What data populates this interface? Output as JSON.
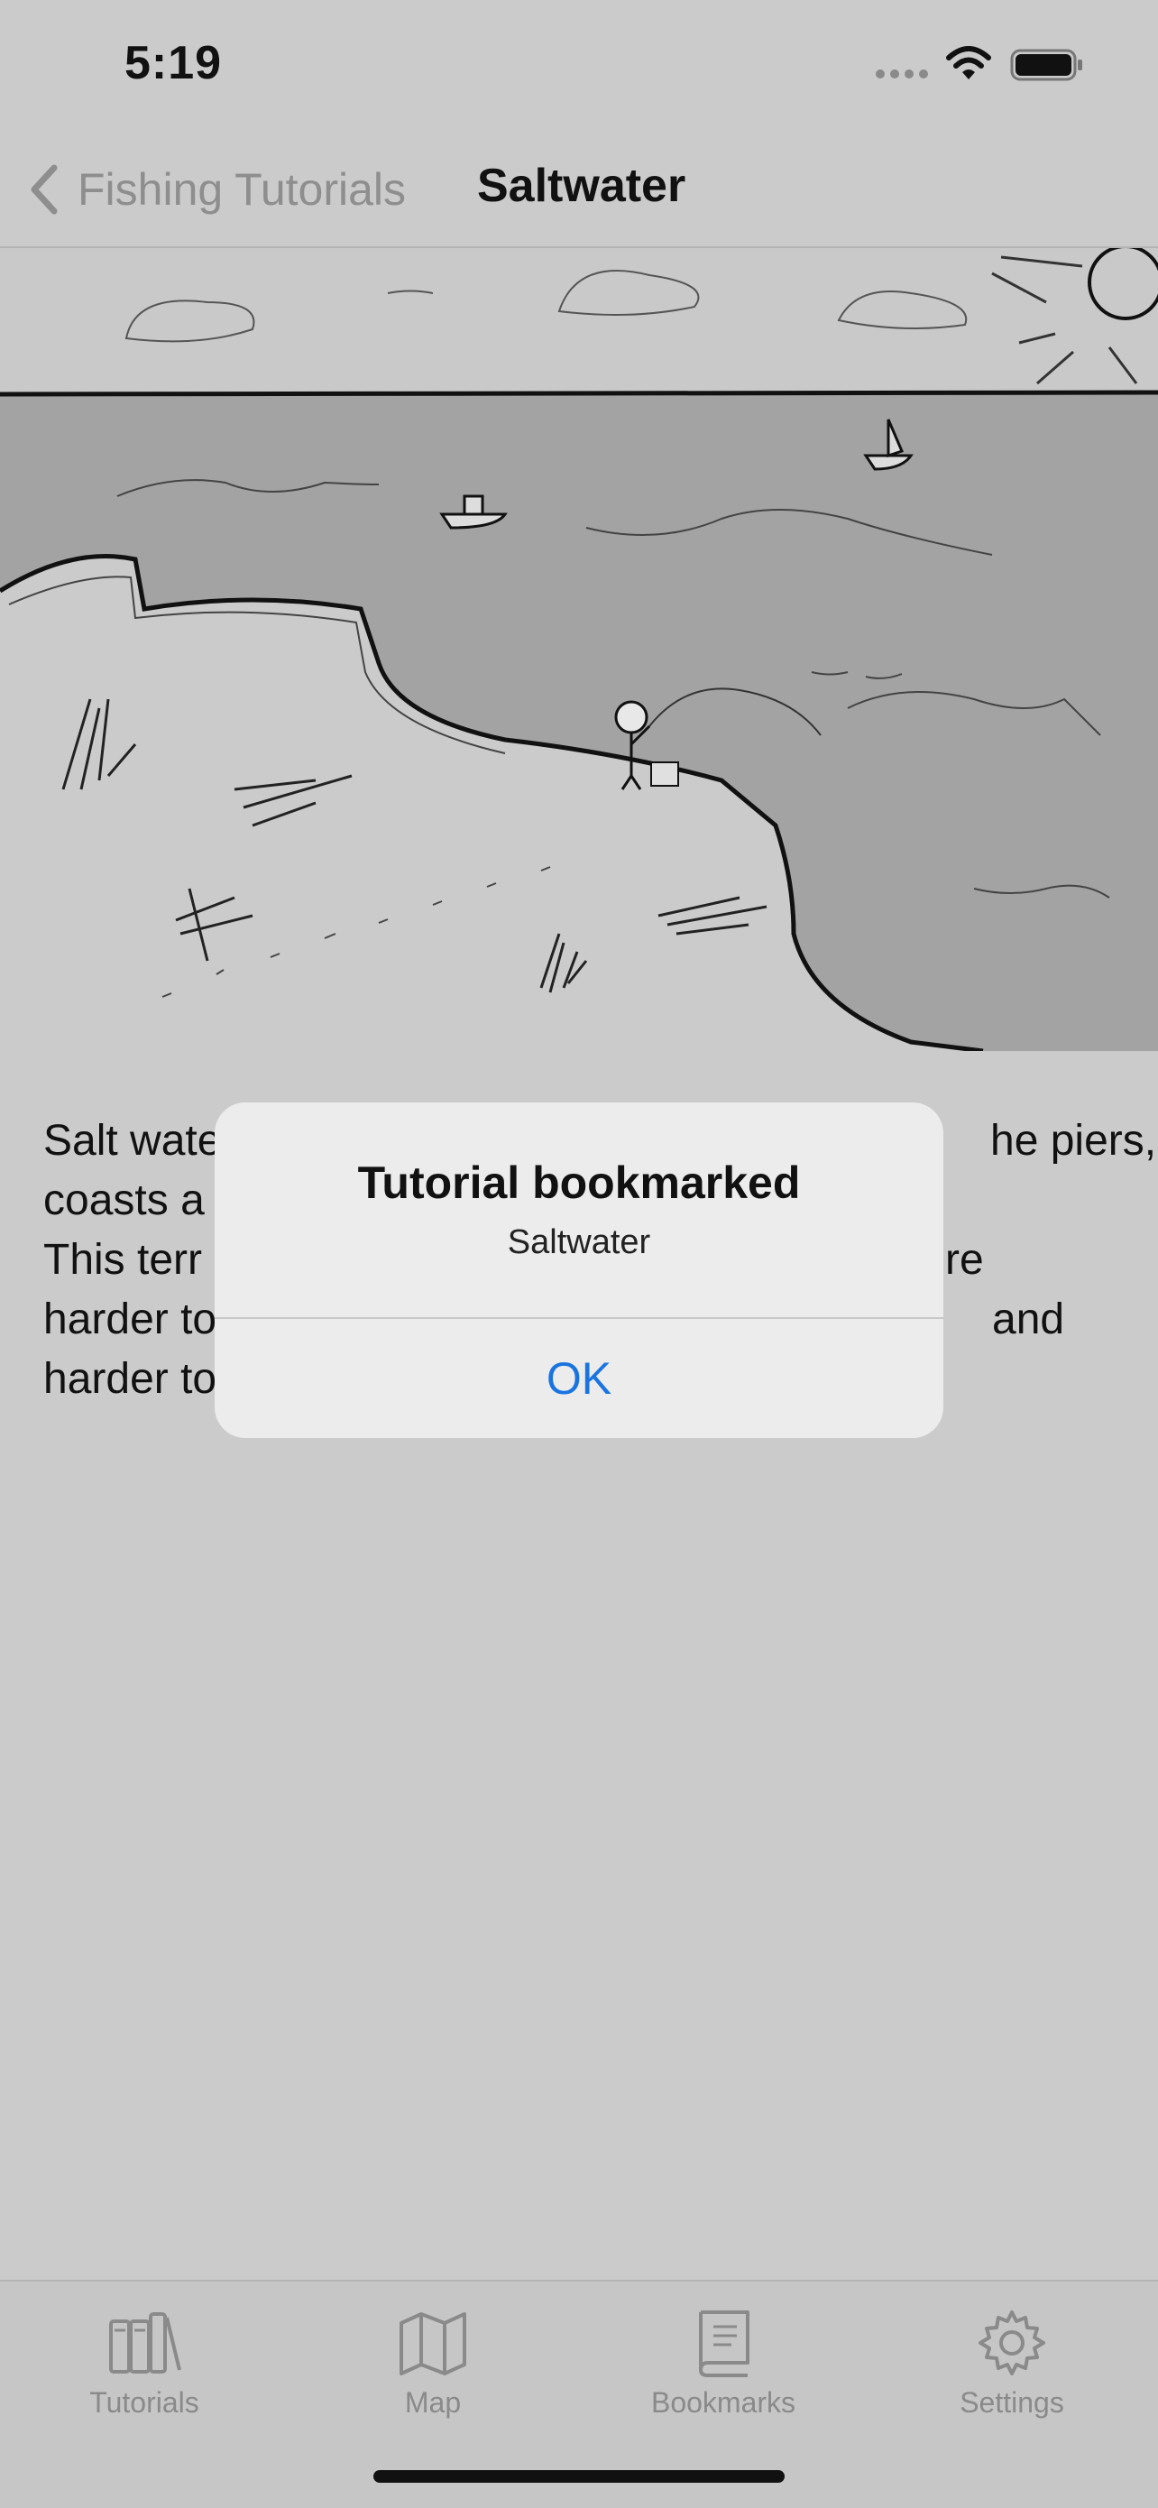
{
  "status_bar": {
    "time": "5:19"
  },
  "nav": {
    "back_label": "Fishing Tutorials",
    "title": "Saltwater"
  },
  "body": {
    "lines": [
      "Salt wate",
      "he piers,",
      "coasts a",
      "This terr",
      "re",
      "harder to",
      "and",
      "harder to"
    ]
  },
  "alert": {
    "title": "Tutorial bookmarked",
    "message": "Saltwater",
    "ok_label": "OK"
  },
  "tabs": [
    {
      "label": "Tutorials",
      "icon": "books-icon"
    },
    {
      "label": "Map",
      "icon": "map-icon"
    },
    {
      "label": "Bookmarks",
      "icon": "book-icon"
    },
    {
      "label": "Settings",
      "icon": "gear-icon"
    }
  ],
  "colors": {
    "accent": "#1a74e0",
    "background": "#cbcbcb",
    "water": "#a3a3a3"
  }
}
